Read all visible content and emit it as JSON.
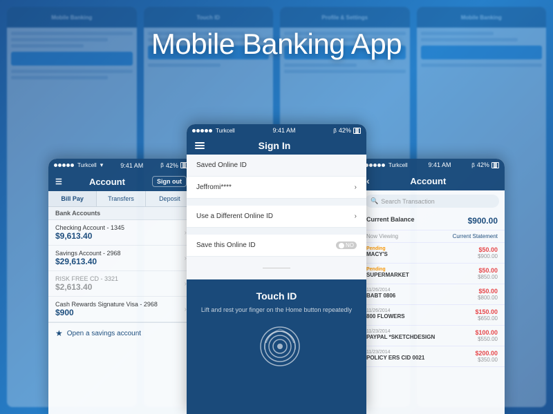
{
  "page": {
    "title": "Mobile Banking App",
    "background_color": "#1a4a7a"
  },
  "phone_left": {
    "status_bar": {
      "carrier": "Turkcell",
      "time": "9:41 AM",
      "bluetooth": "42%"
    },
    "nav": {
      "title": "Account",
      "sign_out": "Sign out"
    },
    "tabs": [
      "Bill Pay",
      "Transfers",
      "Deposit"
    ],
    "section": "Bank Accounts",
    "accounts": [
      {
        "name": "Checking Account - 1345",
        "balance": "$9,613.40",
        "grey": false
      },
      {
        "name": "Savings Account - 2968",
        "balance": "$29,613.40",
        "grey": false
      },
      {
        "name": "RISK FREE CD - 3321",
        "balance": "$2,613.40",
        "grey": true
      },
      {
        "name": "Cash Rewards Signature Visa - 2968",
        "balance": "$900",
        "grey": false
      }
    ],
    "footer": "Open a savings account"
  },
  "phone_center": {
    "status_bar": {
      "carrier": "Turkcell",
      "time": "9:41 AM",
      "bluetooth": "42%"
    },
    "nav_title": "Sign In",
    "rows": [
      {
        "label": "Saved Online ID",
        "value": "",
        "type": "header"
      },
      {
        "label": "Jeffromi****",
        "value": ">",
        "type": "link"
      },
      {
        "label": "Use a Different Online ID",
        "value": ">",
        "type": "link"
      },
      {
        "label": "Save this Online ID",
        "value": "NO",
        "type": "toggle"
      }
    ],
    "touch_id": {
      "title": "Touch ID",
      "subtitle": "Lift and rest your finger on the Home button repeatedly"
    }
  },
  "phone_right": {
    "status_bar": {
      "carrier": "Turkcell",
      "time": "9:41 AM",
      "bluetooth": "42%"
    },
    "nav_title": "Account",
    "search_placeholder": "Search Transaction",
    "current_balance_label": "Current Balance",
    "current_balance": "$900.00",
    "viewing_label": "Now Viewing",
    "viewing_value": "Current Statement",
    "transactions": [
      {
        "status": "Pending",
        "merchant": "MACY'S",
        "date": "",
        "amount": "$50.00",
        "balance": "$900.00"
      },
      {
        "status": "Pending",
        "merchant": "SUPERMARKET",
        "date": "",
        "amount": "$50.00",
        "balance": "$850.00"
      },
      {
        "status": "11/26/2014",
        "merchant": "BABT 0806",
        "date": "",
        "amount": "$50.00",
        "balance": "$800.00"
      },
      {
        "status": "11/26/2014",
        "merchant": "800 FLOWERS",
        "date": "",
        "amount": "$150.00",
        "balance": "$650.00"
      },
      {
        "status": "11/23/2014",
        "merchant": "PAYPAL *SKETCHDESIGN",
        "date": "",
        "amount": "$100.00",
        "balance": "$550.00"
      },
      {
        "status": "11/23/2014",
        "merchant": "POLICY ERS CID 0021",
        "date": "",
        "amount": "$200.00",
        "balance": "$350.00"
      }
    ]
  }
}
